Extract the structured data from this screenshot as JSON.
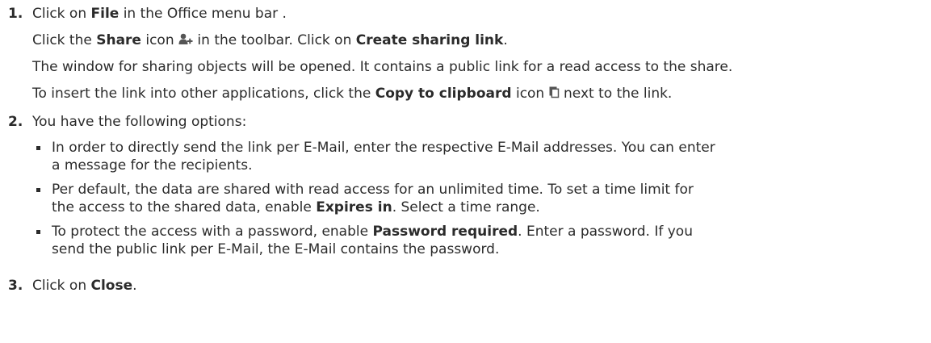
{
  "steps": [
    {
      "number": "1.",
      "lines": [
        {
          "t1": "Click on ",
          "b1": "File",
          "t2": " in the Office menu bar ."
        },
        {
          "t1": "Click the ",
          "b1": "Share",
          "t2": " icon ",
          "icon": "add-user-icon",
          "t3": " in the toolbar. Click on ",
          "b2": "Create sharing link",
          "t4": "."
        },
        {
          "t1": "The window for sharing objects will be opened. It contains a public link for a read access to the share."
        },
        {
          "t1": "To insert the link into other applications, click the ",
          "b1": "Copy to clipboard",
          "t2": " icon ",
          "icon": "copy-clipboard-icon",
          "t3": " next to the link."
        }
      ]
    },
    {
      "number": "2.",
      "intro": "You have the following options:",
      "bullets": [
        {
          "l1": "In order to directly send the link per E-Mail, enter the respective E-Mail addresses. You can enter",
          "l2": "a message for the recipients."
        },
        {
          "l1": "Per default, the data are shared with read access for an unlimited time. To set a time limit for",
          "l2a": "the access to the shared data, enable ",
          "l2b": "Expires in",
          "l2c": ". Select a time range."
        },
        {
          "l1a": "To protect the access with a password, enable ",
          "l1b": "Password required",
          "l1c": ". Enter a password. If you",
          "l2": "send the public link per E-Mail, the E-Mail contains the password."
        }
      ]
    },
    {
      "number": "3.",
      "t1": "Click on ",
      "b1": "Close",
      "t2": "."
    }
  ]
}
